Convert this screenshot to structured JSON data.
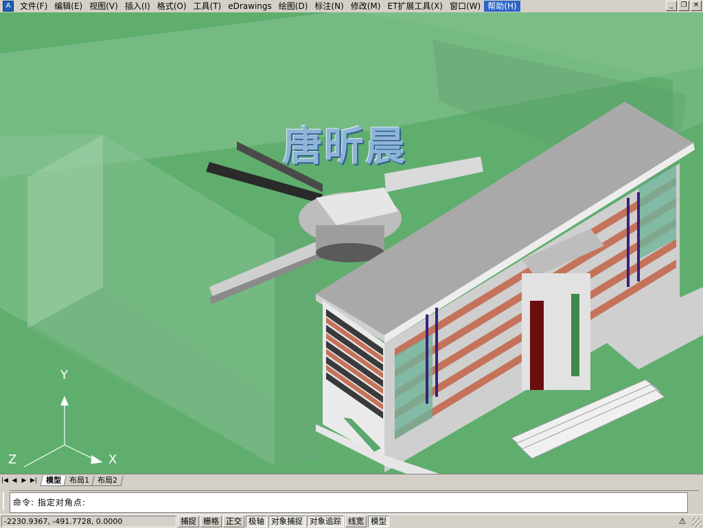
{
  "menu": {
    "app_icon": "autocad-icon",
    "items": [
      {
        "label": "文件(F)"
      },
      {
        "label": "编辑(E)"
      },
      {
        "label": "视图(V)"
      },
      {
        "label": "插入(I)"
      },
      {
        "label": "格式(O)"
      },
      {
        "label": "工具(T)"
      },
      {
        "label": "eDrawings"
      },
      {
        "label": "绘图(D)"
      },
      {
        "label": "标注(N)"
      },
      {
        "label": "修改(M)"
      },
      {
        "label": "ET扩展工具(X)"
      },
      {
        "label": "窗口(W)"
      },
      {
        "label": "帮助(H)"
      }
    ],
    "active_index": 12,
    "window_controls": {
      "minimize": "_",
      "restore": "❐",
      "close": "✕"
    }
  },
  "viewport": {
    "watermark_text": "唐昕晨",
    "ucs": {
      "y_label": "Y",
      "x_label": "X",
      "z_label": "Z"
    },
    "colors": {
      "background": "#5fae6e",
      "accent_brick": "#c4735a",
      "glass": "#6fb49a"
    }
  },
  "tabs": {
    "nav": [
      "|◀",
      "◀",
      "▶",
      "▶|"
    ],
    "items": [
      {
        "label": "模型",
        "active": true
      },
      {
        "label": "布局1",
        "active": false
      },
      {
        "label": "布局2",
        "active": false
      }
    ]
  },
  "command": {
    "text": "命令: 指定对角点:"
  },
  "status": {
    "coordinates": "-2230.9367, -491.7728, 0.0000",
    "toggles": [
      {
        "label": "捕捉",
        "on": false
      },
      {
        "label": "栅格",
        "on": false
      },
      {
        "label": "正交",
        "on": false
      },
      {
        "label": "极轴",
        "on": true
      },
      {
        "label": "对象捕捉",
        "on": true
      },
      {
        "label": "对象追踪",
        "on": true
      },
      {
        "label": "线宽",
        "on": false
      },
      {
        "label": "模型",
        "on": true
      }
    ],
    "tray_icon": "communication-center-icon"
  }
}
